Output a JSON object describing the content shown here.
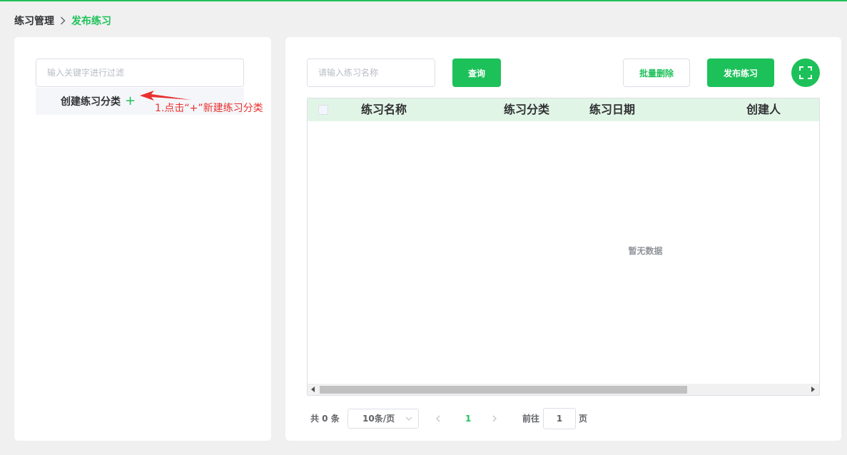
{
  "breadcrumb": {
    "parent": "练习管理",
    "separator": ">",
    "current": "发布练习"
  },
  "left_panel": {
    "filter_placeholder": "输入关键字进行过滤",
    "tree_node_label": "创建练习分类",
    "tree_node_add_icon": "plus-icon",
    "annotation": "1.点击“+”新建练习分类"
  },
  "toolbar": {
    "search_placeholder": "请输入练习名称",
    "query_label": "查询",
    "batch_delete_label": "批量删除",
    "publish_label": "发布练习",
    "fullscreen_icon": "fullscreen-icon"
  },
  "table": {
    "columns": [
      "练习名称",
      "练习分类",
      "练习日期",
      "创建人"
    ],
    "empty_text": "暂无数据"
  },
  "pagination": {
    "total": "共 0 条",
    "page_size": "10条/页",
    "current_page": "1",
    "goto_label": "前往",
    "goto_value": "1",
    "page_suffix": "页"
  },
  "colors": {
    "accent": "#1dc159",
    "header_bg": "#e1f5e6",
    "annotation": "#e8312f"
  }
}
